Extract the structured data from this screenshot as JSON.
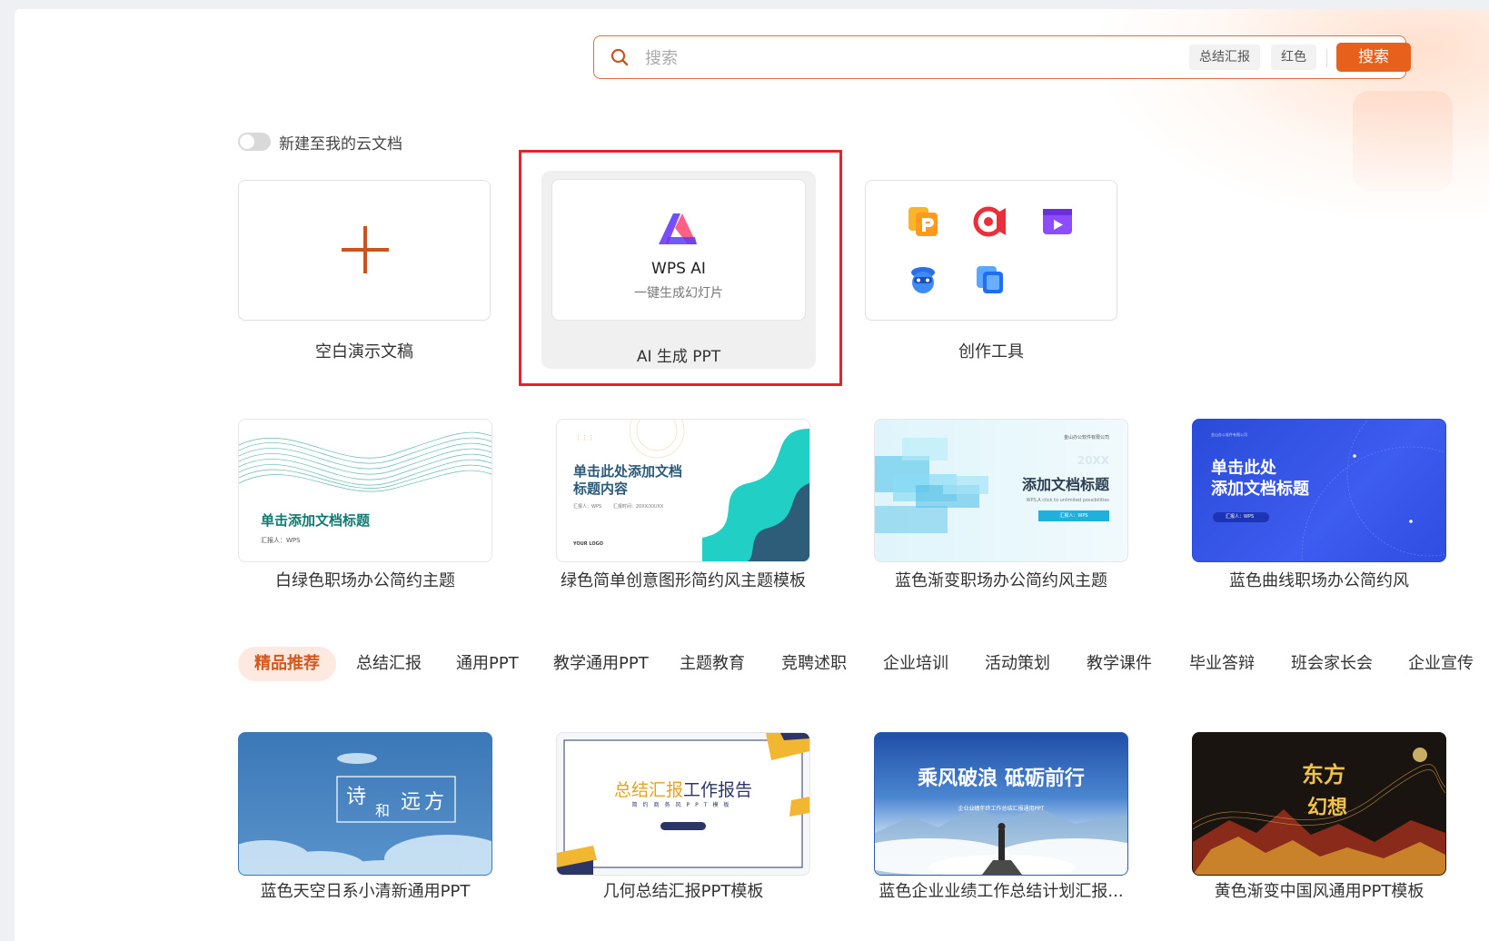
{
  "search": {
    "placeholder": "搜索",
    "tags": [
      "总结汇报",
      "红色"
    ],
    "button_label": "搜索"
  },
  "toggle": {
    "label": "新建至我的云文档",
    "on": false
  },
  "quick_create": {
    "blank": {
      "label": "空白演示文稿"
    },
    "ai": {
      "title": "WPS AI",
      "subtitle": "一键生成幻灯片",
      "label": "AI 生成 PPT"
    },
    "tools": {
      "label": "创作工具"
    }
  },
  "featured_templates": [
    {
      "label": "白绿色职场办公简约主题",
      "title": "单击添加文档标题",
      "reporter": "汇报人：WPS"
    },
    {
      "label": "绿色简单创意图形简约风主题模板",
      "title_line1": "单击此处添加文档",
      "title_line2": "标题内容",
      "meta": "汇报人：WPS        汇报时间：20XX/XX/XX",
      "logo": "YOUR LOGO"
    },
    {
      "label": "蓝色渐变职场办公简约风主题",
      "company": "金山办公软件有限公司",
      "year": "20XX",
      "title": "添加文档标题",
      "subtitle": "WPS,A click to unlimited possibilities",
      "reporter": "汇报人：WPS"
    },
    {
      "label": "蓝色曲线职场办公简约风",
      "company": "金山办公软件有限公司",
      "title_line1": "单击此处",
      "title_line2": "添加文档标题",
      "reporter": "汇报人：WPS"
    }
  ],
  "categories": [
    "精品推荐",
    "总结汇报",
    "通用PPT",
    "教学通用PPT",
    "主题教育",
    "竞聘述职",
    "企业培训",
    "活动策划",
    "教学课件",
    "毕业答辩",
    "班会家长会",
    "企业宣传"
  ],
  "active_category": "精品推荐",
  "recommended_templates": [
    {
      "label": "蓝色天空日系小清新通用PPT",
      "title_top": "诗",
      "title_mid": "远方",
      "title_small": "和"
    },
    {
      "label": "几何总结汇报PPT模板",
      "title_a": "总结汇报",
      "title_b": "工作报告",
      "sub": "简约商务风PPT模板"
    },
    {
      "label": "蓝色企业业绩工作总结计划汇报...",
      "title": "乘风破浪 砥砺前行",
      "sub": "企业业绩年终工作总结汇报通用PPT"
    },
    {
      "label": "黄色渐变中国风通用PPT模板",
      "title_a": "东方",
      "title_b": "幻想"
    }
  ],
  "colors": {
    "accent": "#e8611c",
    "highlight_box": "#e8212b",
    "active_tab_bg": "#fde9e0",
    "active_tab_text": "#d4581e"
  }
}
